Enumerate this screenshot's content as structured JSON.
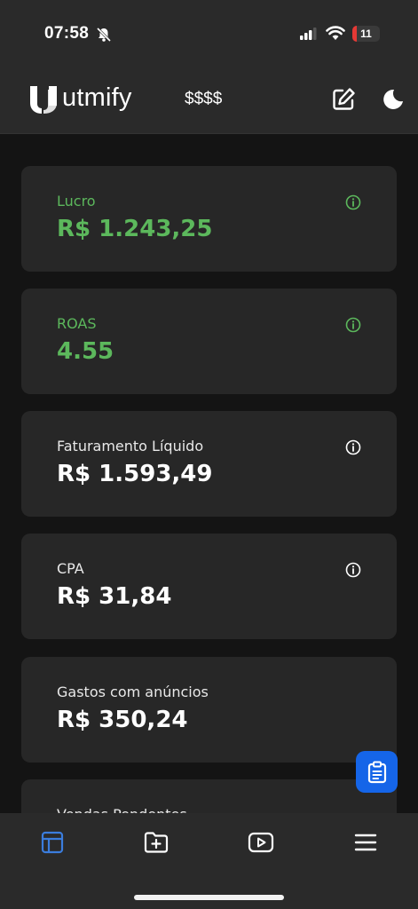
{
  "status_bar": {
    "time": "07:58",
    "battery_level": "11",
    "icons": [
      "bell-slash-icon",
      "cellular-signal-icon",
      "wifi-icon",
      "battery-icon"
    ]
  },
  "header": {
    "logo_text": "utmify",
    "value_mask": "$$$$",
    "icons": [
      "edit-icon",
      "moon-icon"
    ]
  },
  "cards": [
    {
      "label": "Lucro",
      "value": "R$ 1.243,25",
      "highlight": "#5cb85c"
    },
    {
      "label": "ROAS",
      "value": "4.55",
      "highlight": "#5cb85c"
    },
    {
      "label": "Faturamento Líquido",
      "value": "R$ 1.593,49"
    },
    {
      "label": "CPA",
      "value": "R$ 31,84"
    },
    {
      "label": "Gastos com anúncios",
      "value": "R$ 350,24"
    },
    {
      "label": "Vendas Pendentes"
    }
  ],
  "fab_icon": "clipboard-icon",
  "bottom_nav": {
    "items": [
      "dashboard-icon",
      "folder-add-icon",
      "video-play-icon",
      "menu-icon"
    ],
    "active_color": "#3b7ddd"
  },
  "colors": {
    "background": "#141414",
    "surface": "#272727",
    "bar": "#2a2a2a",
    "accent_green": "#5cb85c",
    "fab_blue": "#1565e8"
  }
}
